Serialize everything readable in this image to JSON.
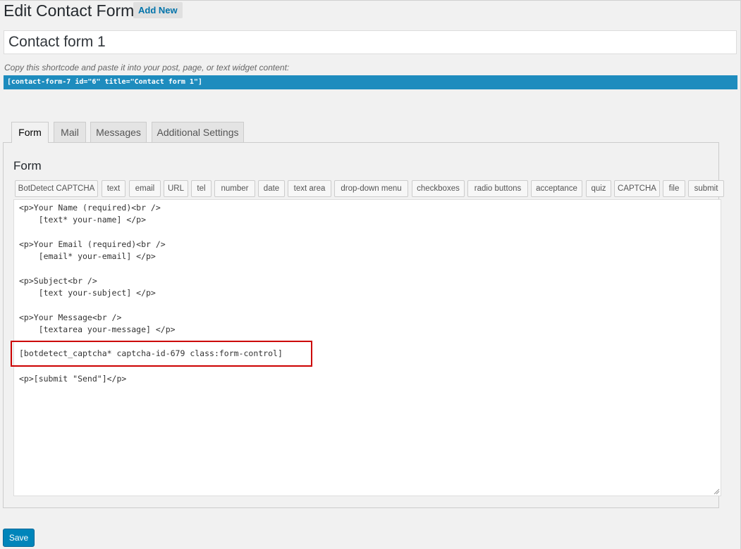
{
  "header": {
    "title": "Edit Contact Form",
    "add_new_label": "Add New"
  },
  "form_title": {
    "value": "Contact form 1"
  },
  "shortcode": {
    "hint": "Copy this shortcode and paste it into your post, page, or text widget content:",
    "code": "[contact-form-7 id=\"6\" title=\"Contact form 1\"]"
  },
  "tabs": [
    {
      "label": "Form",
      "active": true
    },
    {
      "label": "Mail",
      "active": false
    },
    {
      "label": "Messages",
      "active": false
    },
    {
      "label": "Additional Settings",
      "active": false
    }
  ],
  "panel": {
    "title": "Form"
  },
  "tag_buttons": [
    "BotDetect CAPTCHA",
    "text",
    "email",
    "URL",
    "tel",
    "number",
    "date",
    "text area",
    "drop-down menu",
    "checkboxes",
    "radio buttons",
    "acceptance",
    "quiz",
    "CAPTCHA",
    "file",
    "submit"
  ],
  "editor": {
    "lines": [
      "<p>Your Name (required)<br />",
      "    [text* your-name] </p>",
      "<p>Your Email (required)<br />",
      "    [email* your-email] </p>",
      "<p>Subject<br />",
      "    [text your-subject] </p>",
      "<p>Your Message<br />",
      "    [textarea your-message] </p>",
      "[botdetect_captcha* captcha-id-679 class:form-control]",
      "<p>[submit \"Send\"]</p>"
    ]
  },
  "save_label": "Save",
  "colors": {
    "accent": "#0085ba",
    "shortcode_bg": "#1e8cbe",
    "highlight_border": "#cc0000"
  }
}
